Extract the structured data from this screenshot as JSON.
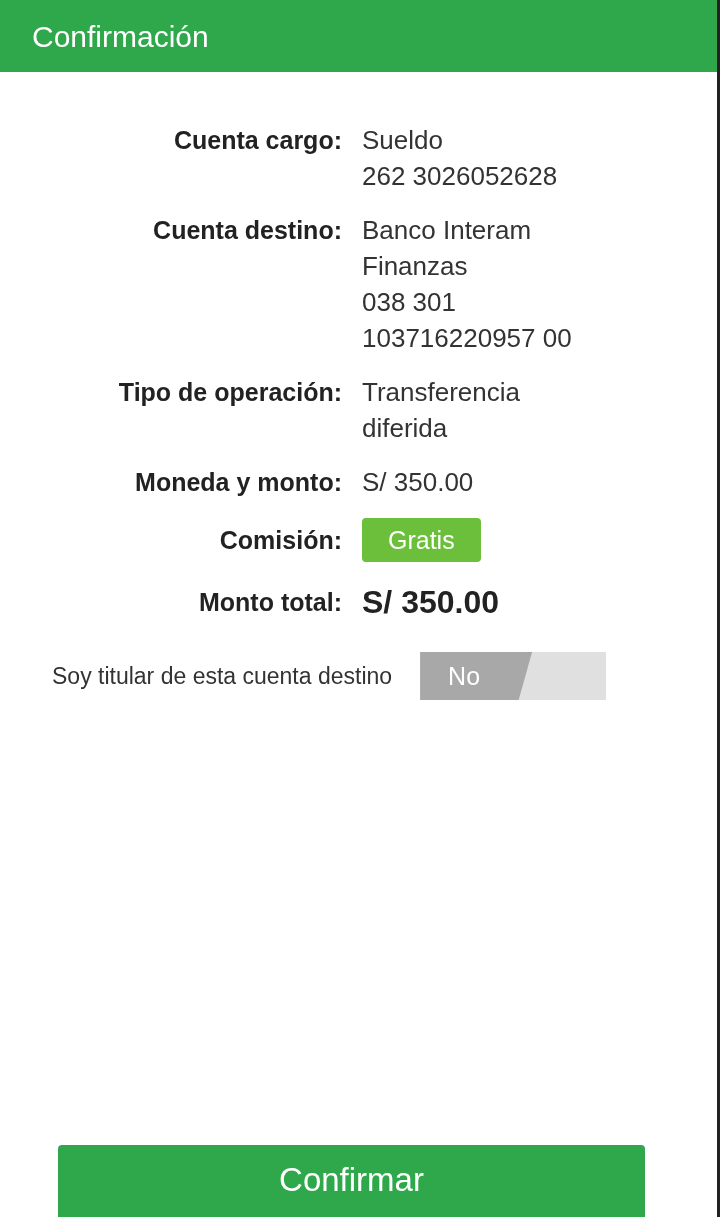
{
  "header": {
    "title": "Confirmación"
  },
  "details": [
    {
      "label": "Cuenta cargo:",
      "kind": "text",
      "lines": [
        "Sueldo",
        "262 3026052628"
      ]
    },
    {
      "label": "Cuenta destino:",
      "kind": "text",
      "lines": [
        "Banco Interam",
        "Finanzas",
        "038 301",
        "103716220957 00"
      ]
    },
    {
      "label": "Tipo de operación:",
      "kind": "text",
      "lines": [
        "Transferencia",
        "diferida"
      ]
    },
    {
      "label": "Moneda y monto:",
      "kind": "text",
      "lines": [
        "S/ 350.00"
      ]
    },
    {
      "label": "Comisión:",
      "kind": "badge",
      "lines": [
        "Gratis"
      ]
    },
    {
      "label": "Monto total:",
      "kind": "total",
      "lines": [
        "S/ 350.00"
      ]
    }
  ],
  "owner_toggle": {
    "label": "Soy titular de esta cuenta destino",
    "value": "No",
    "on": false
  },
  "confirm_button": {
    "label": "Confirmar"
  }
}
